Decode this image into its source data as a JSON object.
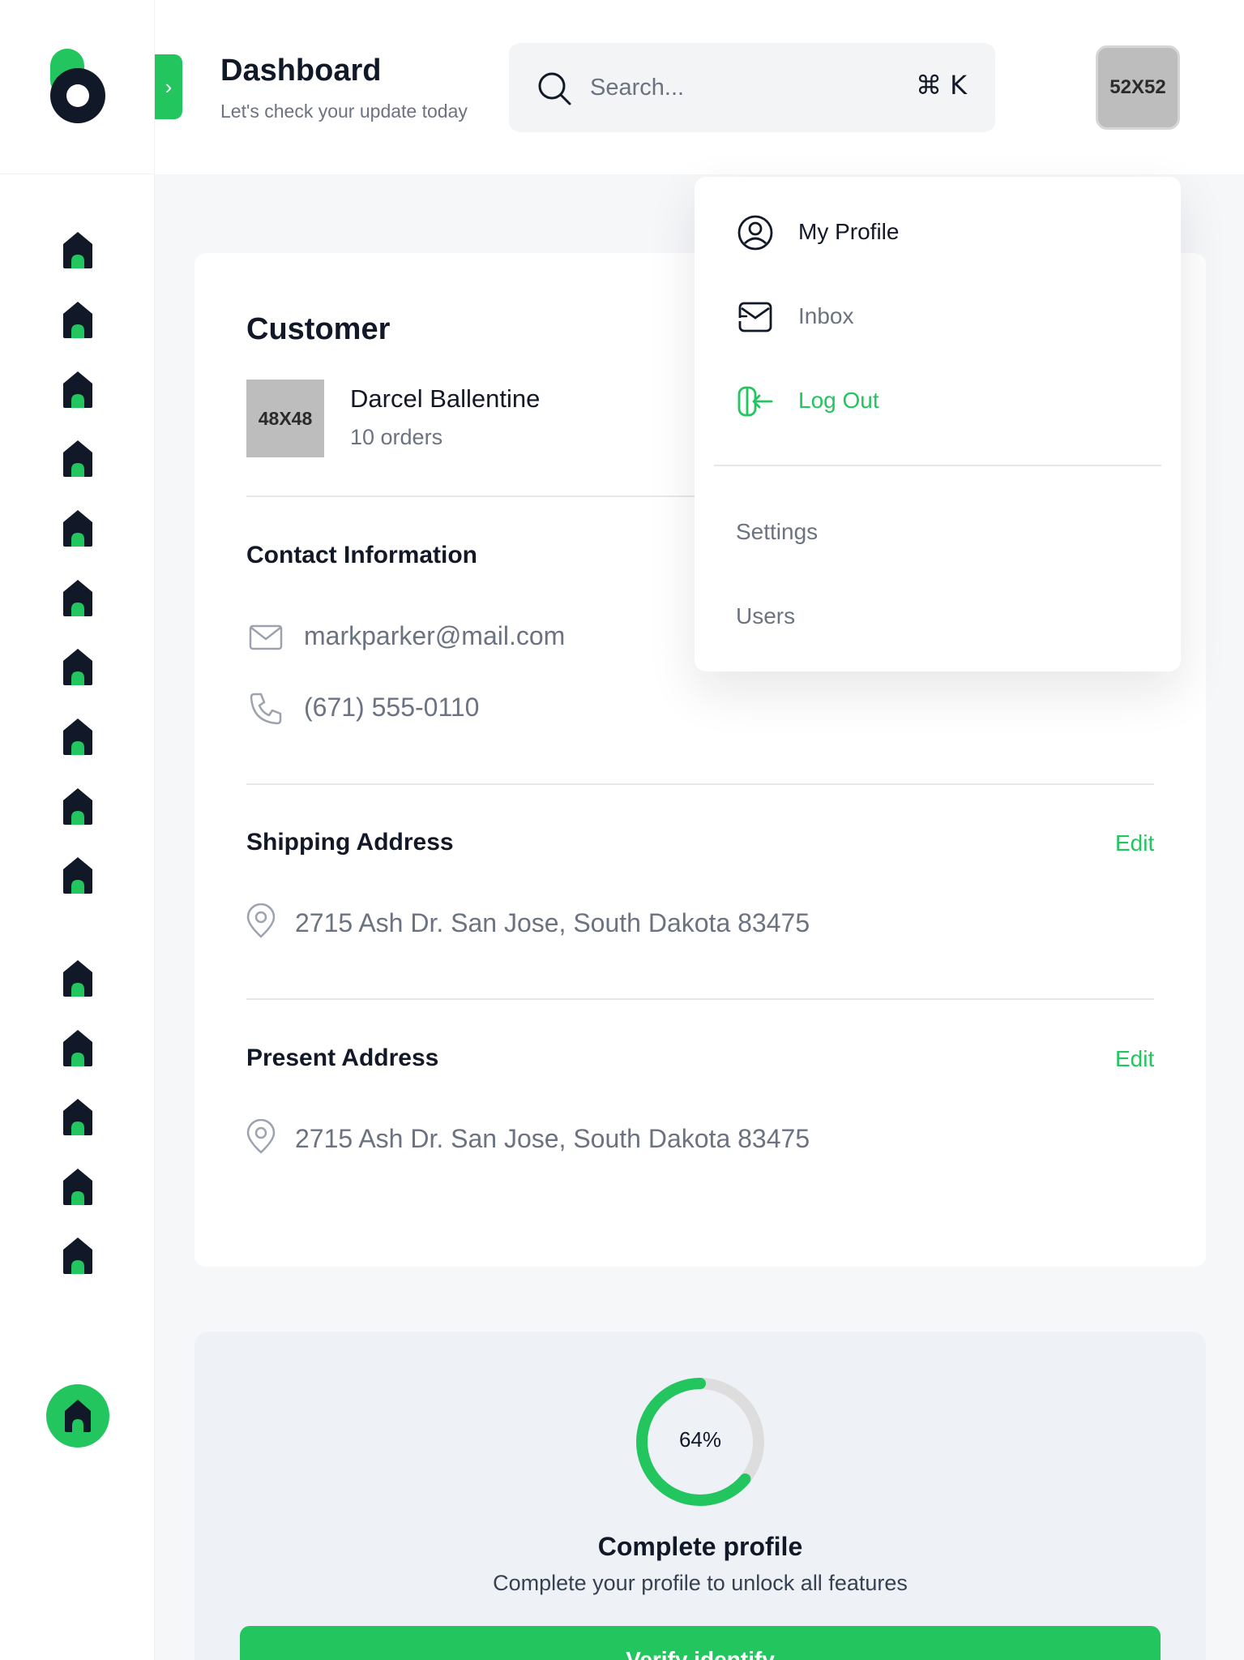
{
  "header": {
    "title": "Dashboard",
    "subtitle": "Let's check your update today",
    "search_placeholder": "Search...",
    "shortcut": "⌘ K",
    "avatar_label": "52X52",
    "toggle_glyph": "›"
  },
  "colors": {
    "accent": "#22c55e",
    "dark": "#111827",
    "muted": "#6b7280"
  },
  "sidebar": {
    "nav_icon": "home-icon",
    "nav_count": 15,
    "active_icon": "home-icon"
  },
  "customer": {
    "title": "Customer",
    "avatar_label": "48X48",
    "name": "Darcel Ballentine",
    "orders": "10 orders",
    "contact_title": "Contact Information",
    "email": "markparker@mail.com",
    "phone": "(671) 555-0110",
    "shipping_title": "Shipping Address",
    "shipping_edit": "Edit",
    "shipping_address": "2715 Ash Dr. San Jose, South Dakota 83475",
    "present_title": "Present Address",
    "present_edit": "Edit",
    "present_address": "2715 Ash Dr. San Jose, South Dakota 83475"
  },
  "dropdown": {
    "items": [
      {
        "label": "My Profile",
        "icon": "user-circle-icon"
      },
      {
        "label": "Inbox",
        "icon": "inbox-icon"
      },
      {
        "label": "Log Out",
        "icon": "logout-icon"
      }
    ],
    "secondary": [
      {
        "label": "Settings"
      },
      {
        "label": "Users"
      }
    ]
  },
  "profile_completion": {
    "percent_label": "64%",
    "percent_value": 64,
    "title": "Complete profile",
    "subtitle": "Complete your profile to unlock all features",
    "button_label": "Verify identify"
  }
}
